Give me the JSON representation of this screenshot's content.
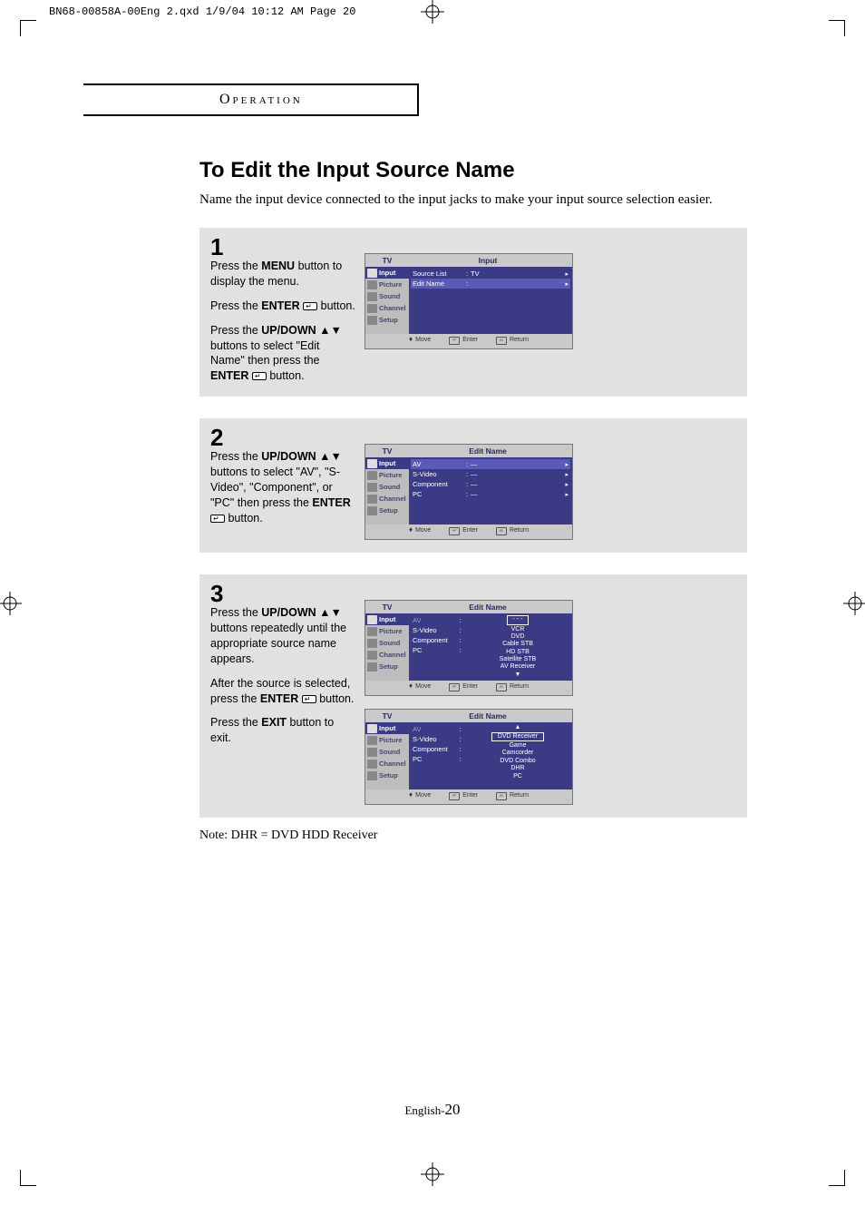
{
  "printmark": "BN68-00858A-00Eng 2.qxd  1/9/04 10:12 AM  Page 20",
  "section_header": "Operation",
  "title": "To Edit the Input Source Name",
  "intro": "Name the input device connected to the input jacks to make your input source selection easier.",
  "steps": {
    "s1": {
      "num": "1",
      "p1a": "Press the ",
      "p1b": "MENU",
      "p1c": " button to display the menu.",
      "p2a": "Press the ",
      "p2b": "ENTER",
      "p2c": " button.",
      "p3a": "Press the ",
      "p3b": "UP/DOWN",
      "p3c": " ▲▼ buttons to select \"Edit Name\" then press the ",
      "p3d": "ENTER",
      "p3e": "  button."
    },
    "s2": {
      "num": "2",
      "p1a": "Press the ",
      "p1b": "UP/DOWN",
      "p1c": " ▲▼ buttons to select  \"AV\", \"S-Video\", \"Component\", or \"PC\" then press the ",
      "p1d": "ENTER",
      "p1e": "  button."
    },
    "s3": {
      "num": "3",
      "p1a": "Press the ",
      "p1b": "UP/DOWN",
      "p1c": " ▲▼  buttons repeatedly until the appropriate source name appears.",
      "p2a": "After the source is selected, press the ",
      "p2b": "ENTER",
      "p2c": "  button.",
      "p3a": "Press the ",
      "p3b": "EXIT",
      "p3c": " button to exit."
    }
  },
  "osd": {
    "side": {
      "input": "Input",
      "picture": "Picture",
      "sound": "Sound",
      "channel": "Channel",
      "setup": "Setup"
    },
    "tv": "TV",
    "footer": {
      "move": "Move",
      "enter": "Enter",
      "return": "Return"
    },
    "fig1": {
      "title": "Input",
      "rows": [
        {
          "lbl": "Source List",
          "val": "TV"
        },
        {
          "lbl": "Edit Name",
          "val": "",
          "hl": true
        }
      ]
    },
    "fig2": {
      "title": "Edit Name",
      "rows": [
        {
          "lbl": "AV",
          "val": "—",
          "hl": true
        },
        {
          "lbl": "S-Video",
          "val": "—"
        },
        {
          "lbl": "Component",
          "val": "—"
        },
        {
          "lbl": "PC",
          "val": "—"
        }
      ]
    },
    "fig3a": {
      "title": "Edit Name",
      "left": [
        {
          "lbl": "AV",
          "dim": true
        },
        {
          "lbl": "S-Video"
        },
        {
          "lbl": "Component"
        },
        {
          "lbl": "PC"
        }
      ],
      "col": [
        "- - -",
        "VCR",
        "DVD",
        "Cable STB",
        "HD STB",
        "Satellite STB",
        "AV Receiver",
        "▼"
      ],
      "boxedIndex": 0
    },
    "fig3b": {
      "title": "Edit Name",
      "left": [
        {
          "lbl": "AV",
          "dim": true
        },
        {
          "lbl": "S-Video"
        },
        {
          "lbl": "Component"
        },
        {
          "lbl": "PC"
        }
      ],
      "col": [
        "▲",
        "DVD Receiver",
        "Game",
        "Camcorder",
        "DVD Combo",
        "DHR",
        "PC"
      ],
      "boxedIndex": 1
    }
  },
  "note": "Note: DHR = DVD HDD Receiver",
  "pagenum_prefix": "English-",
  "pagenum": "20"
}
